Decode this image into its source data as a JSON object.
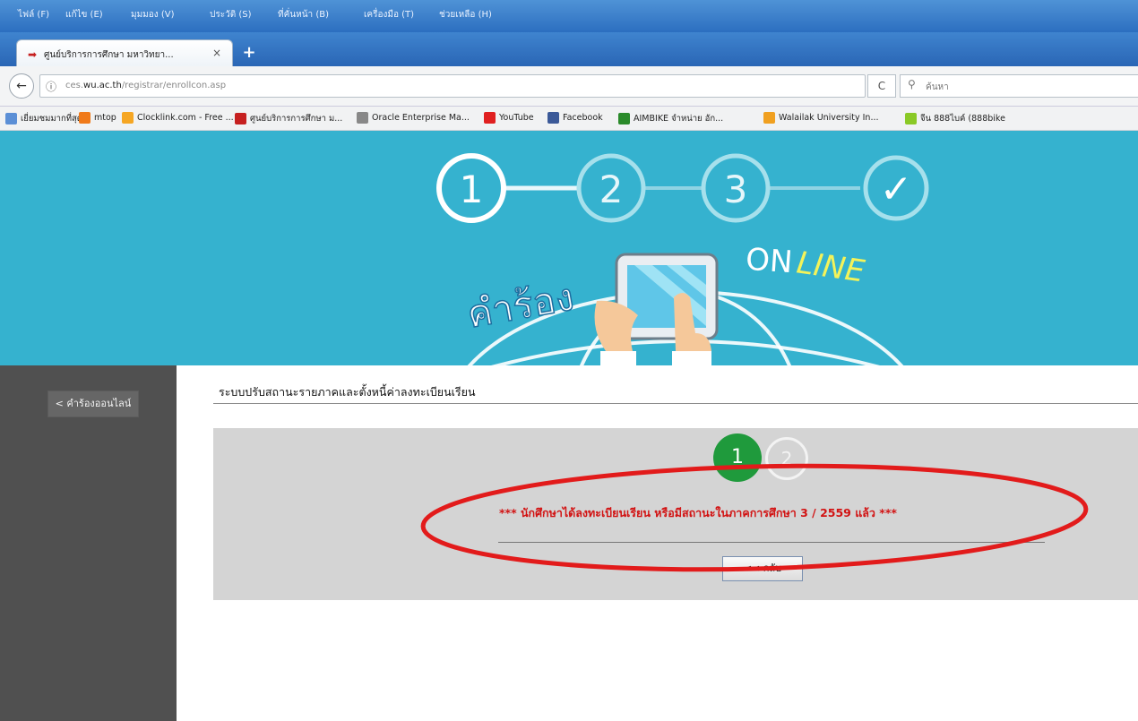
{
  "browser": {
    "menu": [
      "ไฟล์ (F)",
      "แก้ไข (E)",
      "มุมมอง (V)",
      "ประวัติ (S)",
      "ที่คั่นหน้า (B)",
      "เครื่องมือ (T)",
      "ช่วยเหลือ (H)"
    ],
    "tab_title": "ศูนย์บริการการศึกษา มหาวิทยา...",
    "tab_close": "×",
    "new_tab": "+",
    "back": "←",
    "info": "ⓘ",
    "url_prefix": "ces.",
    "url_domain": "wu.ac.th",
    "url_path": "/registrar/enrollcon.asp",
    "reload": "C",
    "search_placeholder": "ค้นหา",
    "bookmarks": [
      {
        "label": "เยี่ยมชมมากที่สุด",
        "color": "#5b8fd6"
      },
      {
        "label": "mtop",
        "color": "#f07a1a"
      },
      {
        "label": "Clocklink.com - Free ...",
        "color": "#f5a623"
      },
      {
        "label": "ศูนย์บริการการศึกษา ม...",
        "color": "#c62020"
      },
      {
        "label": "Oracle Enterprise Ma...",
        "color": "#888888"
      },
      {
        "label": "YouTube",
        "color": "#e02020"
      },
      {
        "label": "Facebook",
        "color": "#3b5998"
      },
      {
        "label": "AIMBIKE จำหน่าย อัก...",
        "color": "#2a8a2a"
      },
      {
        "label": "Walailak University In...",
        "color": "#f0a020"
      },
      {
        "label": "จีน 888ไบค์ (888bike",
        "color": "#8ac926"
      }
    ]
  },
  "banner": {
    "steps": [
      "1",
      "2",
      "3",
      "✓"
    ],
    "word_thai": "คำร้อง",
    "word_on": "ON",
    "word_line": "LINE"
  },
  "sidebar": {
    "button_label": "< คำร้องออนไลน์"
  },
  "content": {
    "title": "ระบบปรับสถานะรายภาคและตั้งหนี้ค่าลงทะเบียนเรียน",
    "step_current": "1",
    "step_next": "2",
    "message": "*** นักศึกษาได้ลงทะเบียนเรียน หรือมีสถานะในภาคการศึกษา 3 / 2559 แล้ว ***",
    "back_button": "<< กลับ"
  },
  "colors": {
    "banner": "#35b2cf",
    "sidebar": "#505050",
    "step_active": "#1f9a3c",
    "message": "#d21313",
    "annotation": "#e21b1b"
  }
}
